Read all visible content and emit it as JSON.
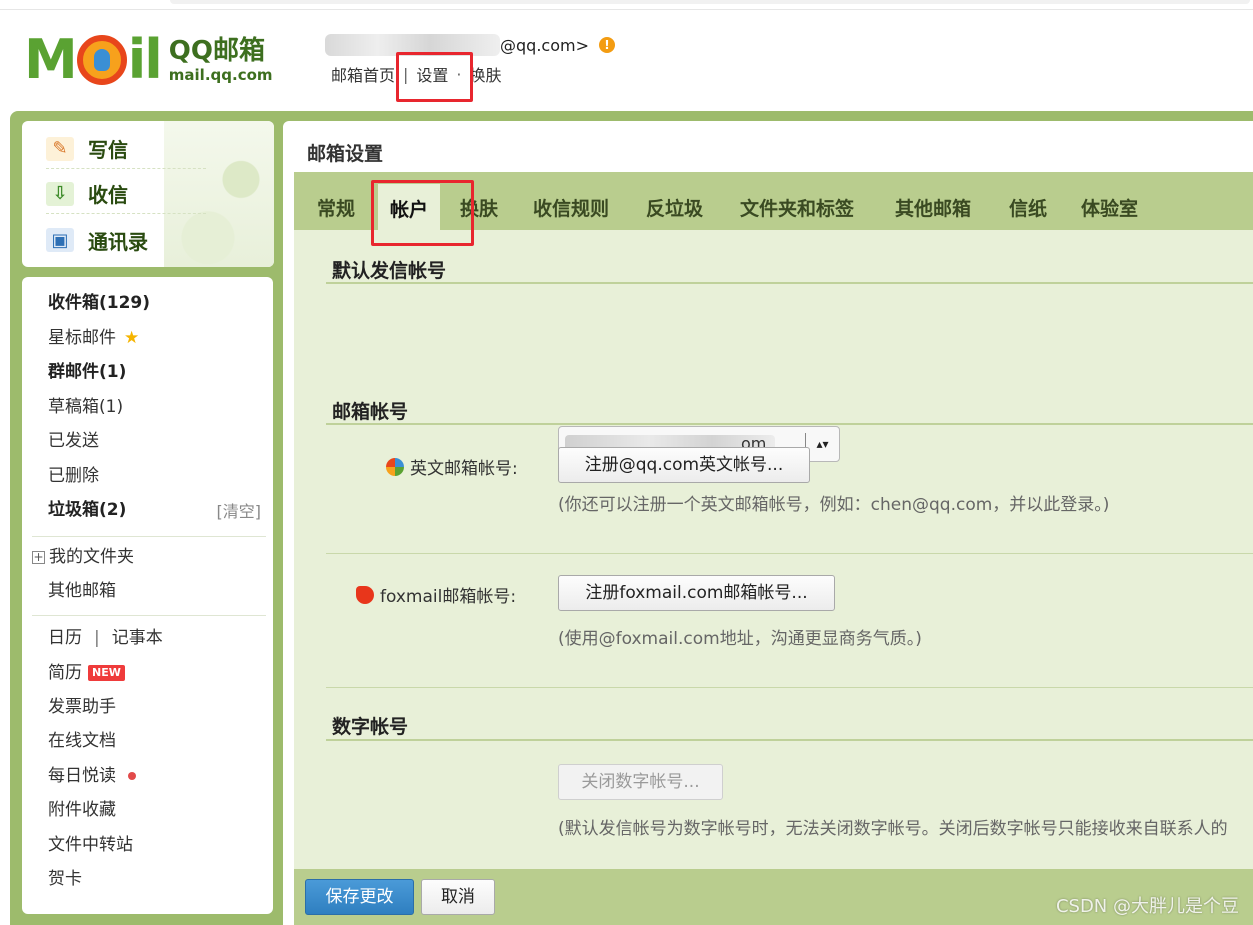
{
  "header": {
    "brand_cn": "QQ邮箱",
    "brand_url": "mail.qq.com",
    "account_suffix": "@qq.com>",
    "links": [
      "邮箱首页",
      "设置",
      "换肤"
    ],
    "link_sep": "|"
  },
  "quick_actions": [
    {
      "label": "写信",
      "icon": "pencil-icon"
    },
    {
      "label": "收信",
      "icon": "inbox-download-icon"
    },
    {
      "label": "通讯录",
      "icon": "contact-card-icon"
    }
  ],
  "folders": {
    "inbox": "收件箱(129)",
    "starred": "星标邮件",
    "group": "群邮件(1)",
    "drafts": "草稿箱(1)",
    "sent": "已发送",
    "deleted": "已删除",
    "spam": "垃圾箱(2)",
    "spam_clear": "[清空]",
    "my_folders": "我的文件夹",
    "other_mailbox": "其他邮箱",
    "calendar": "日历",
    "notes_sep": "|",
    "notes": "记事本",
    "resume": "简历",
    "new_badge": "NEW",
    "invoice": "发票助手",
    "docs": "在线文档",
    "daily_read": "每日悦读",
    "attachments": "附件收藏",
    "transfer": "文件中转站",
    "cards": "贺卡"
  },
  "main": {
    "title": "邮箱设置",
    "tabs": [
      "常规",
      "帐户",
      "换肤",
      "收信规则",
      "反垃圾",
      "文件夹和标签",
      "其他邮箱",
      "信纸",
      "体验室"
    ],
    "active_tab": "帐户",
    "sections": {
      "default_sender": "默认发信帐号",
      "mail_accounts": "邮箱帐号",
      "digit_account": "数字帐号"
    },
    "select_visible": "om",
    "english_label": "英文邮箱帐号:",
    "english_button": "注册@qq.com英文帐号...",
    "english_hint": "(你还可以注册一个英文邮箱帐号，例如：chen@qq.com，并以此登录。)",
    "foxmail_label": "foxmail邮箱帐号:",
    "foxmail_button": "注册foxmail.com邮箱帐号...",
    "foxmail_hint": "(使用@foxmail.com地址，沟通更显商务气质。)",
    "digit_button": "关闭数字帐号...",
    "digit_hint": "(默认发信帐号为数字帐号时，无法关闭数字帐号。关闭后数字帐号只能接收来自联系人的"
  },
  "footer": {
    "save": "保存更改",
    "cancel": "取消"
  },
  "watermark": "CSDN @大胖儿是个豆",
  "colors": {
    "frame_green": "#9dbb6c",
    "tab_bar": "#b9cd8e",
    "content_bg": "#e8f0d8",
    "highlight_red": "#e8262e",
    "save_blue": "#2f7fc0"
  }
}
